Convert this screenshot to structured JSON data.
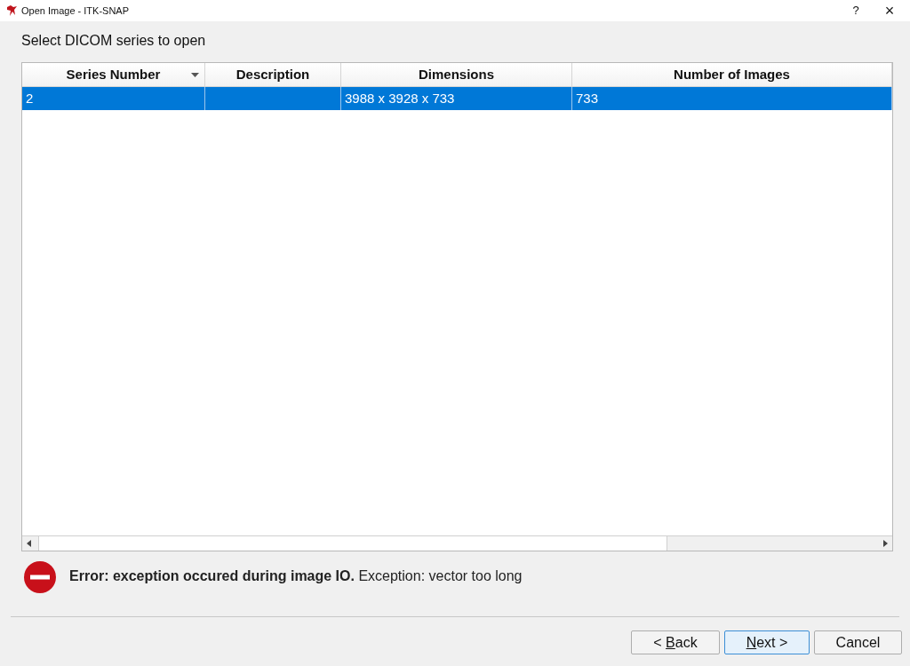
{
  "window": {
    "title": "Open Image - ITK-SNAP",
    "help": "?",
    "close": "×"
  },
  "heading": "Select DICOM series to open",
  "table": {
    "columns": [
      {
        "label": "Series Number",
        "sorted": true
      },
      {
        "label": "Description",
        "sorted": false
      },
      {
        "label": "Dimensions",
        "sorted": false
      },
      {
        "label": "Number of Images",
        "sorted": false
      }
    ],
    "rows": [
      {
        "cells": [
          "2",
          "",
          "3988 x 3928 x 733",
          "733"
        ],
        "selected": true
      }
    ]
  },
  "error": "**Error: exception occured during image IO.** Exception: vector too long",
  "buttons": [
    {
      "before": "< ",
      "key": "B",
      "after": "ack",
      "default": false
    },
    {
      "key": "N",
      "after": "ext >",
      "default": true
    },
    {
      "before": "Cancel",
      "default": false
    }
  ]
}
